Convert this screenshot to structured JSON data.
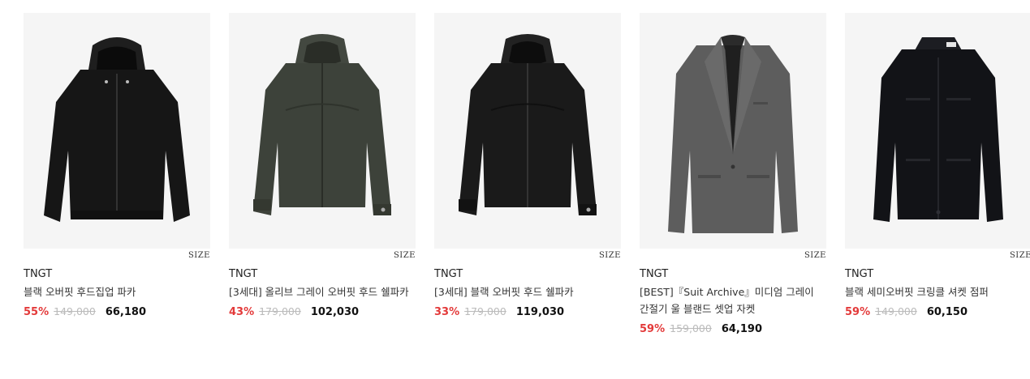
{
  "products": [
    {
      "brand": "TNGT",
      "name": "블랙 오버핏 후드집업 파카",
      "discount": "55%",
      "original_price": "149,000",
      "price": "66,180",
      "size_label": "SIZE",
      "image": "black-hooded-zip-parka",
      "garment_color": "#151515"
    },
    {
      "brand": "TNGT",
      "name": "[3세대] 올리브 그레이 오버핏 후드 쉘파카",
      "discount": "43%",
      "original_price": "179,000",
      "price": "102,030",
      "size_label": "SIZE",
      "image": "olive-gray-hooded-shell-parka",
      "garment_color": "#3d423a"
    },
    {
      "brand": "TNGT",
      "name": "[3세대] 블랙 오버핏 후드 쉘파카",
      "discount": "33%",
      "original_price": "179,000",
      "price": "119,030",
      "size_label": "SIZE",
      "image": "black-hooded-shell-parka",
      "garment_color": "#1a1a1a"
    },
    {
      "brand": "TNGT",
      "name": "[BEST]『Suit Archive』미디엄 그레이 간절기 울 블랜드 셋업 자켓",
      "discount": "59%",
      "original_price": "159,000",
      "price": "64,190",
      "size_label": "SIZE",
      "image": "medium-gray-wool-suit-jacket",
      "garment_color": "#5d5d5d"
    },
    {
      "brand": "TNGT",
      "name": "블랙 세미오버핏 크링클 셔켓 점퍼",
      "discount": "59%",
      "original_price": "149,000",
      "price": "60,150",
      "size_label": "SIZE",
      "image": "black-crinkle-shirt-jacket",
      "garment_color": "#121317"
    }
  ],
  "colors": {
    "discount": "#e33a3a",
    "original_price": "#bbbbbb",
    "thumb_bg": "#f5f5f5"
  }
}
